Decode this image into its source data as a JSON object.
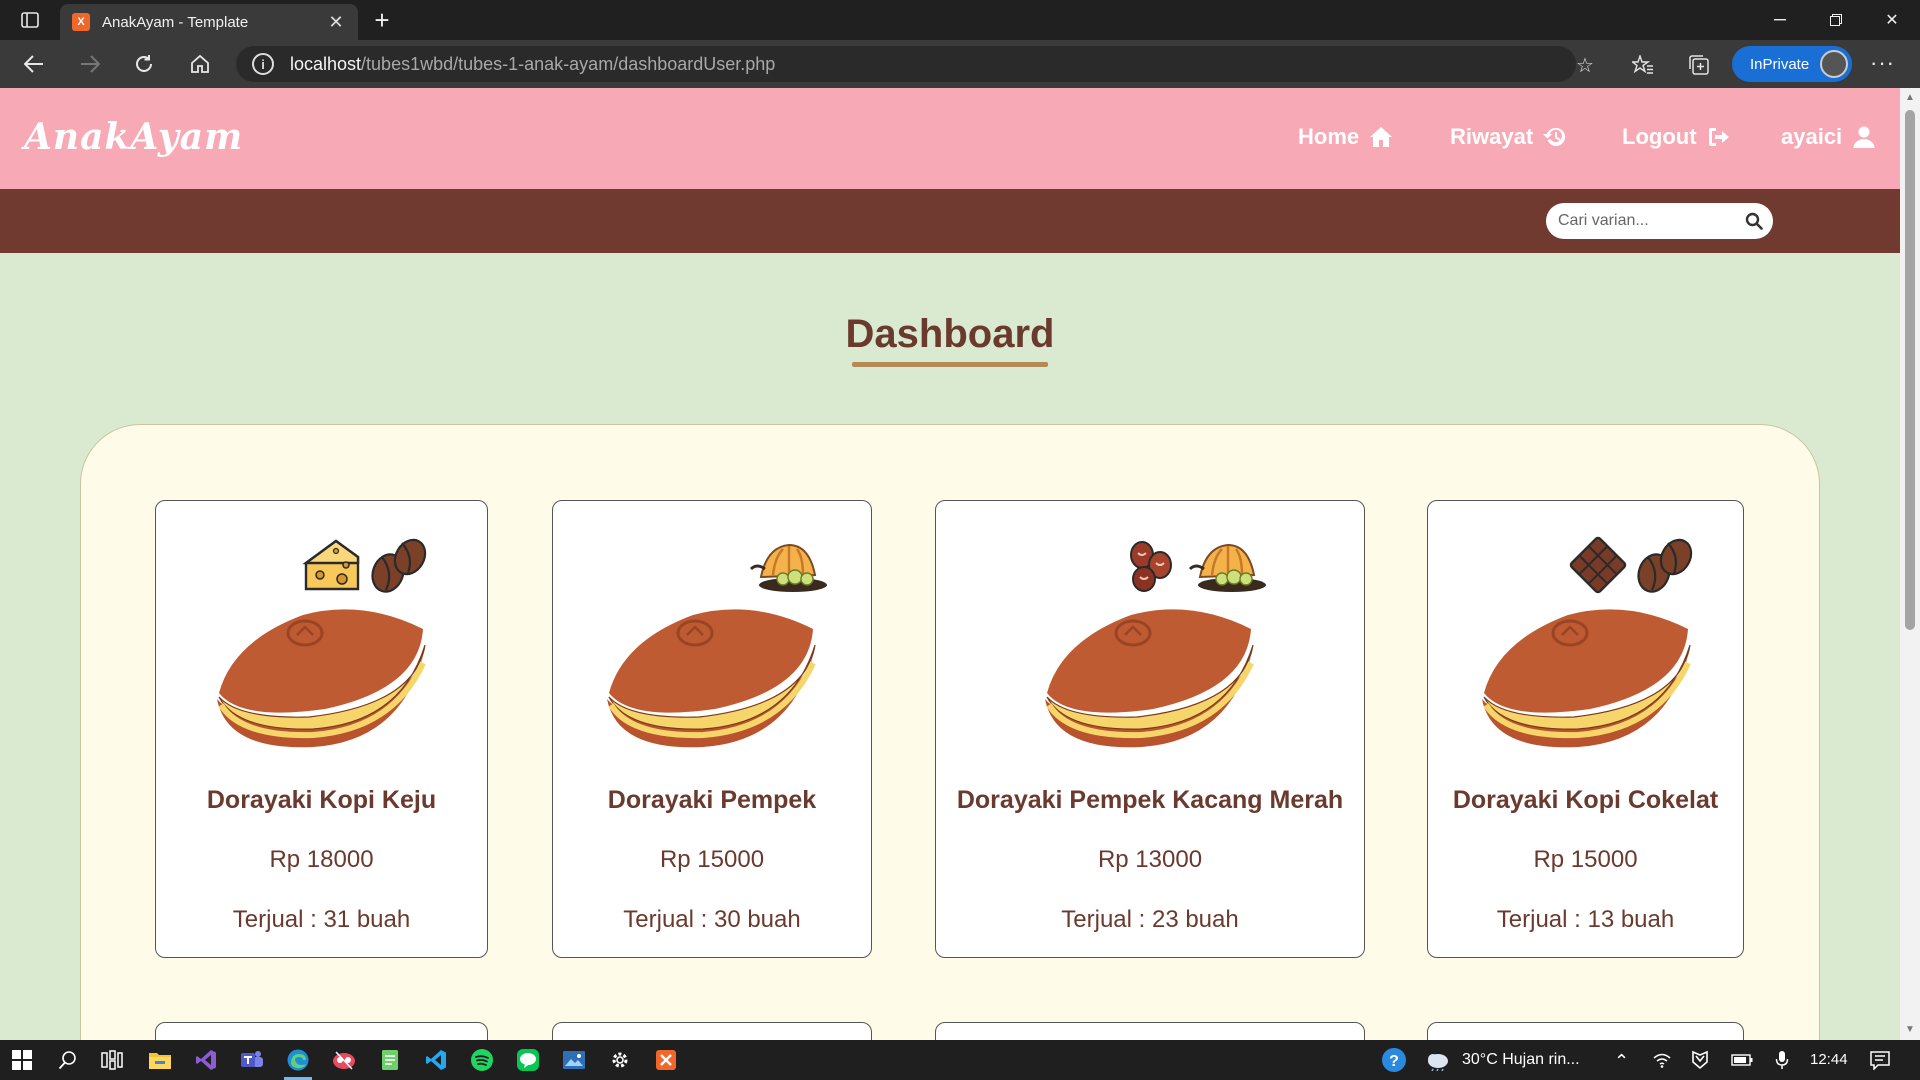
{
  "browser": {
    "tab_title": "AnakAyam - Template",
    "url_host": "localhost",
    "url_path": "/tubes1wbd/tubes-1-anak-ayam/dashboardUser.php",
    "inprivate_label": "InPrivate",
    "favicon_text": "X"
  },
  "header": {
    "logo": "AnakAyam",
    "nav": {
      "home": "Home",
      "riwayat": "Riwayat",
      "logout": "Logout",
      "user": "ayaici"
    }
  },
  "search": {
    "placeholder": "Cari varian..."
  },
  "page": {
    "title": "Dashboard"
  },
  "products": [
    {
      "name": "Dorayaki Kopi Keju",
      "price": "Rp 18000",
      "sold": "Terjual : 31 buah",
      "toppings": [
        "cheese-icon",
        "coffee-bean-icon"
      ]
    },
    {
      "name": "Dorayaki Pempek",
      "price": "Rp 15000",
      "sold": "Terjual : 30 buah",
      "toppings": [
        "pempek-icon"
      ]
    },
    {
      "name": "Dorayaki Pempek Kacang Merah",
      "price": "Rp 13000",
      "sold": "Terjual : 23 buah",
      "toppings": [
        "red-bean-icon",
        "pempek-icon"
      ]
    },
    {
      "name": "Dorayaki Kopi Cokelat",
      "price": "Rp 15000",
      "sold": "Terjual : 13 buah",
      "toppings": [
        "chocolate-icon",
        "coffee-bean-icon"
      ]
    }
  ],
  "taskbar": {
    "weather": "30°C  Hujan rin...",
    "time": "12:44"
  },
  "colors": {
    "header_pink": "#f7aab6",
    "subbar_brown": "#703a31",
    "page_green": "#d9ead0",
    "panel_cream": "#fefce8",
    "text_brown": "#6b3a2e"
  }
}
